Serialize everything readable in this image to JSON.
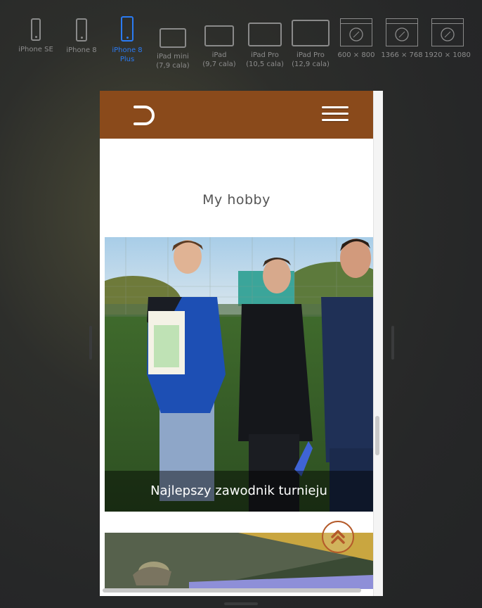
{
  "devices": [
    {
      "name": "iPhone SE",
      "sub": "",
      "kind": "phone",
      "active": false
    },
    {
      "name": "iPhone 8",
      "sub": "",
      "kind": "phone",
      "active": false
    },
    {
      "name": "iPhone 8",
      "sub": "Plus",
      "kind": "phone",
      "active": true
    },
    {
      "name": "iPad mini",
      "sub": "(7,9 cala)",
      "kind": "tablet",
      "active": false
    },
    {
      "name": "iPad",
      "sub": "(9,7 cala)",
      "kind": "tablet",
      "active": false
    },
    {
      "name": "iPad Pro",
      "sub": "(10,5 cala)",
      "kind": "tablet",
      "active": false
    },
    {
      "name": "iPad Pro",
      "sub": "(12,9 cala)",
      "kind": "tablet",
      "active": false
    },
    {
      "name": "600 × 800",
      "sub": "",
      "kind": "screen",
      "active": false
    },
    {
      "name": "1366 × 768",
      "sub": "",
      "kind": "screen",
      "active": false
    },
    {
      "name": "1920 × 1080",
      "sub": "",
      "kind": "screen",
      "active": false
    }
  ],
  "colors": {
    "active_device": "#2b7bf3",
    "header": "#8a4a1b",
    "accent": "#b45a2a"
  },
  "site": {
    "section_title": "My hobby",
    "photo_caption": "Najlepszy zawodnik turnieju"
  }
}
